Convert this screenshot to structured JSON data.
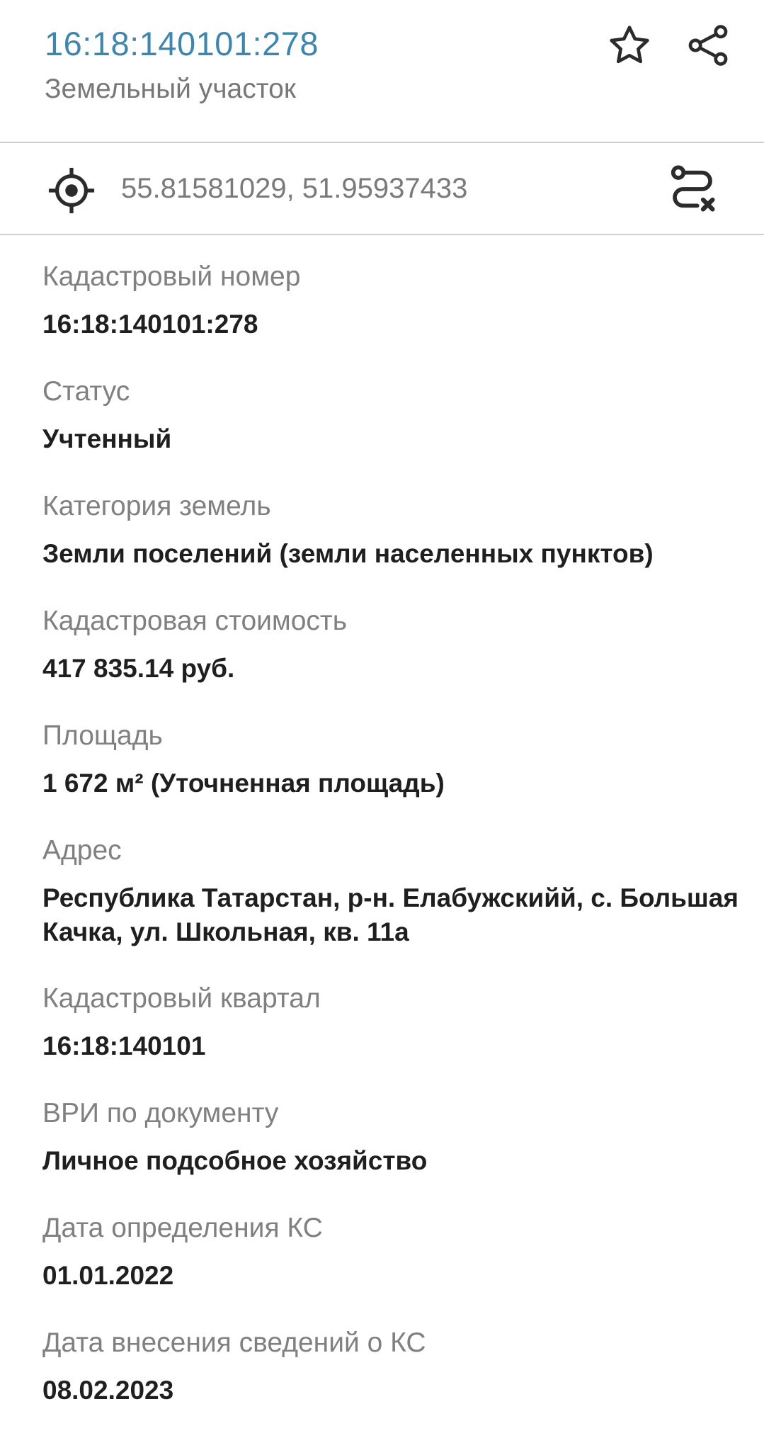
{
  "header": {
    "title": "16:18:140101:278",
    "subtitle": "Земельный участок",
    "star_icon": "star-icon",
    "share_icon": "share-icon"
  },
  "coords": {
    "locate_icon": "crosshair-icon",
    "value": "55.81581029, 51.95937433",
    "route_icon": "route-icon"
  },
  "fields": [
    {
      "label": "Кадастровый номер",
      "value": "16:18:140101:278"
    },
    {
      "label": "Статус",
      "value": "Учтенный"
    },
    {
      "label": "Категория земель",
      "value": "Земли поселений (земли населенных пунктов)"
    },
    {
      "label": "Кадастровая стоимость",
      "value": "417 835.14 руб."
    },
    {
      "label": "Площадь",
      "value": "1 672 м² (Уточненная площадь)"
    },
    {
      "label": "Адрес",
      "value_line1": "Республика Татарстан, р-н. Елабужскийй, с. Большая",
      "value_line2": "Качка, ул. Школьная, кв. 11а"
    },
    {
      "label": "Кадастровый квартал",
      "value": "16:18:140101"
    },
    {
      "label": "ВРИ по документу",
      "value": "Личное подсобное хозяйство"
    },
    {
      "label": "Дата определения КС",
      "value": "01.01.2022"
    },
    {
      "label": "Дата внесения сведений о КС",
      "value": "08.02.2023"
    }
  ],
  "colors": {
    "title": "#3f86ad",
    "label": "#808080",
    "value": "#1f1f1f",
    "divider": "#cfcfcf"
  }
}
